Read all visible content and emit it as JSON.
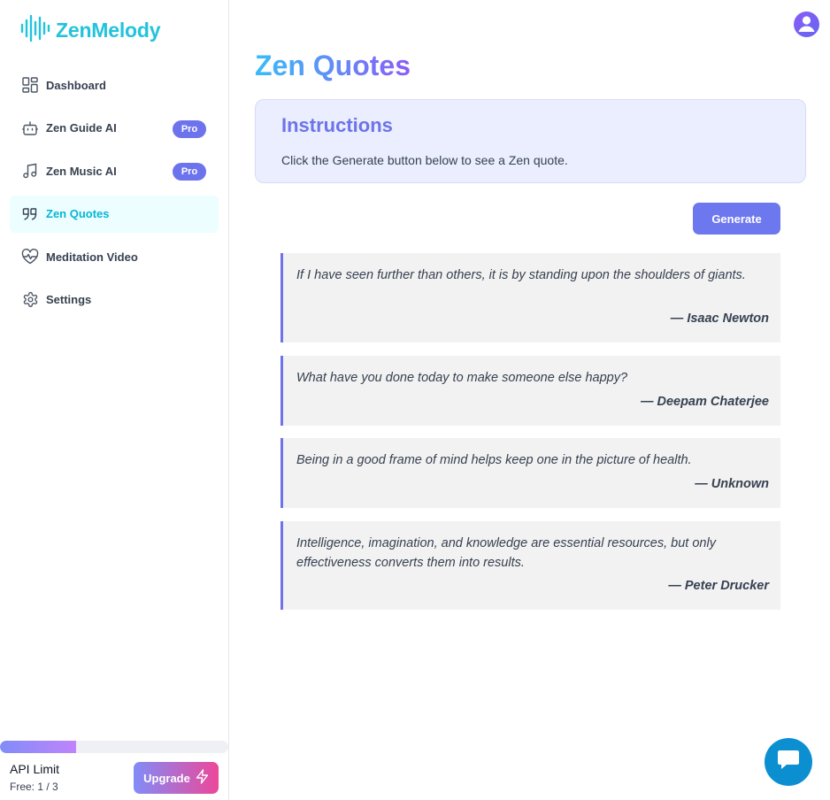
{
  "app": {
    "name": "ZenMelody",
    "brand_color": "#22c3dc",
    "accent": "#6d73e8"
  },
  "sidebar": {
    "items": [
      {
        "label": "Dashboard",
        "icon": "dashboard-icon",
        "active": false,
        "badge": ""
      },
      {
        "label": "Zen Guide AI",
        "icon": "bot-icon",
        "active": false,
        "badge": "Pro"
      },
      {
        "label": "Zen Music AI",
        "icon": "music-icon",
        "active": false,
        "badge": "Pro"
      },
      {
        "label": "Zen Quotes",
        "icon": "quote-icon",
        "active": true,
        "badge": ""
      },
      {
        "label": "Meditation Video",
        "icon": "heart-pulse-icon",
        "active": false,
        "badge": ""
      },
      {
        "label": "Settings",
        "icon": "gear-icon",
        "active": false,
        "badge": ""
      }
    ],
    "api_limit": {
      "title": "API Limit",
      "usage_text": "Free: 1 / 3",
      "used": 1,
      "total": 3
    },
    "upgrade_label": "Upgrade"
  },
  "main": {
    "title": "Zen Quotes",
    "instructions": {
      "title": "Instructions",
      "text": "Click the Generate button below to see a Zen quote."
    },
    "generate_label": "Generate",
    "quotes": [
      {
        "text": "If I have seen further than others, it is by standing upon the shoulders of giants.",
        "author": "— Isaac Newton"
      },
      {
        "text": "What have you done today to make someone else happy?",
        "author": "— Deepam Chaterjee"
      },
      {
        "text": "Being in a good frame of mind helps keep one in the picture of health.",
        "author": "— Unknown"
      },
      {
        "text": "Intelligence, imagination, and knowledge are essential resources, but only effectiveness converts them into results.",
        "author": "— Peter Drucker"
      }
    ]
  }
}
